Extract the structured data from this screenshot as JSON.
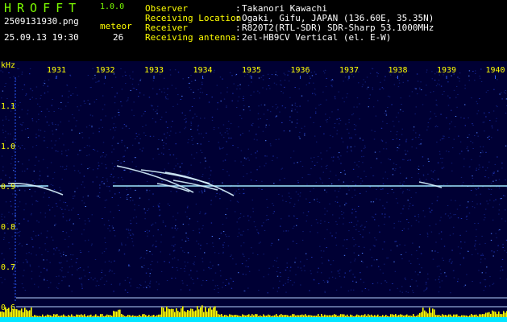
{
  "header": {
    "app_title": "HROFFT",
    "app_version": "1.0.0",
    "file_name": "2509131930.png",
    "date_time": "25.09.13 19:30",
    "meteor_label": "meteor",
    "meteor_count": "26"
  },
  "info": [
    {
      "label": "Observer",
      "value": "Takanori Kawachi"
    },
    {
      "label": "Receiving Location",
      "value": "Ogaki, Gifu, JAPAN (136.60E, 35.35N)"
    },
    {
      "label": "Receiver",
      "value": "R820T2(RTL-SDR) SDR-Sharp 53.1000MHz"
    },
    {
      "label": "Receiving antenna",
      "value": "2el-HB9CV Vertical (el. E-W)"
    }
  ],
  "spectrogram": {
    "y_unit": "kHz",
    "time_ticks": [
      "1931",
      "1932",
      "1933",
      "1934",
      "1935",
      "1936",
      "1937",
      "1938",
      "1939",
      "1940"
    ],
    "freq_ticks": [
      "1.1",
      "1.0",
      "0.9",
      "0.8",
      "0.7",
      "0.6"
    ],
    "colors": {
      "background": "#000034",
      "grid": "#2b5bff",
      "carrier": "#a0e8ff",
      "trace": "#d8f4ff",
      "level_fill": "#ffff00",
      "level_base": "#00e5ff",
      "axis_text": "#ffff00"
    }
  }
}
